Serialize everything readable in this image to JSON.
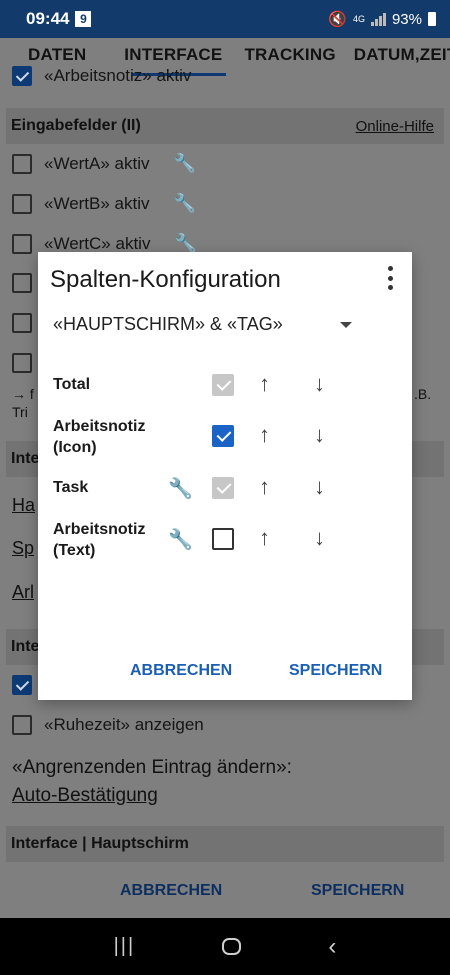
{
  "status": {
    "time": "09:44",
    "notif": "9",
    "network": "4G",
    "battery": "93%"
  },
  "tabs": [
    {
      "label": "DATEN"
    },
    {
      "label": "INTERFACE"
    },
    {
      "label": "TRACKING"
    },
    {
      "label": "DATUM,ZEIT"
    }
  ],
  "background": {
    "partial_top": "«Arbeitsnotiz» aktiv",
    "section1": {
      "title": "Eingabefelder (II)",
      "help": "Online-Hilfe"
    },
    "fields": [
      "«WertA» aktiv",
      "«WertB» aktiv",
      "«WertC» aktiv"
    ],
    "note_left": "→ f",
    "note_left2": "Tri",
    "note_right": ".B.",
    "section2_title": "Inte",
    "links": [
      "Ha",
      "Sp",
      "Arl"
    ],
    "section3_title": "Inte",
    "ruhezeit": "«Ruhezeit» anzeigen",
    "angrenzend": "«Angrenzenden Eintrag ändern»:",
    "auto": "Auto-Bestätigung",
    "section4_title": "Interface | Hauptschirm",
    "cancel": "ABBRECHEN",
    "save": "SPEICHERN"
  },
  "dialog": {
    "title": "Spalten-Konfiguration",
    "selected": "«HAUPTSCHIRM» & «TAG»",
    "rows": [
      {
        "label": "Total",
        "label2": "",
        "state": "disabled",
        "wrench": false
      },
      {
        "label": "Arbeitsnotiz",
        "label2": "(Icon)",
        "state": "checked",
        "wrench": false
      },
      {
        "label": "Task",
        "label2": "",
        "state": "disabled",
        "wrench": true
      },
      {
        "label": "Arbeitsnotiz",
        "label2": "(Text)",
        "state": "unchecked",
        "wrench": true
      }
    ],
    "cancel": "ABBRECHEN",
    "save": "SPEICHERN"
  },
  "icons": {
    "up": "↑",
    "down": "↓",
    "wrench": "🔧",
    "mute": "🔇",
    "back": "‹"
  },
  "colors": {
    "accent": "#1b5fb5",
    "statusbar": "#123a6a"
  }
}
